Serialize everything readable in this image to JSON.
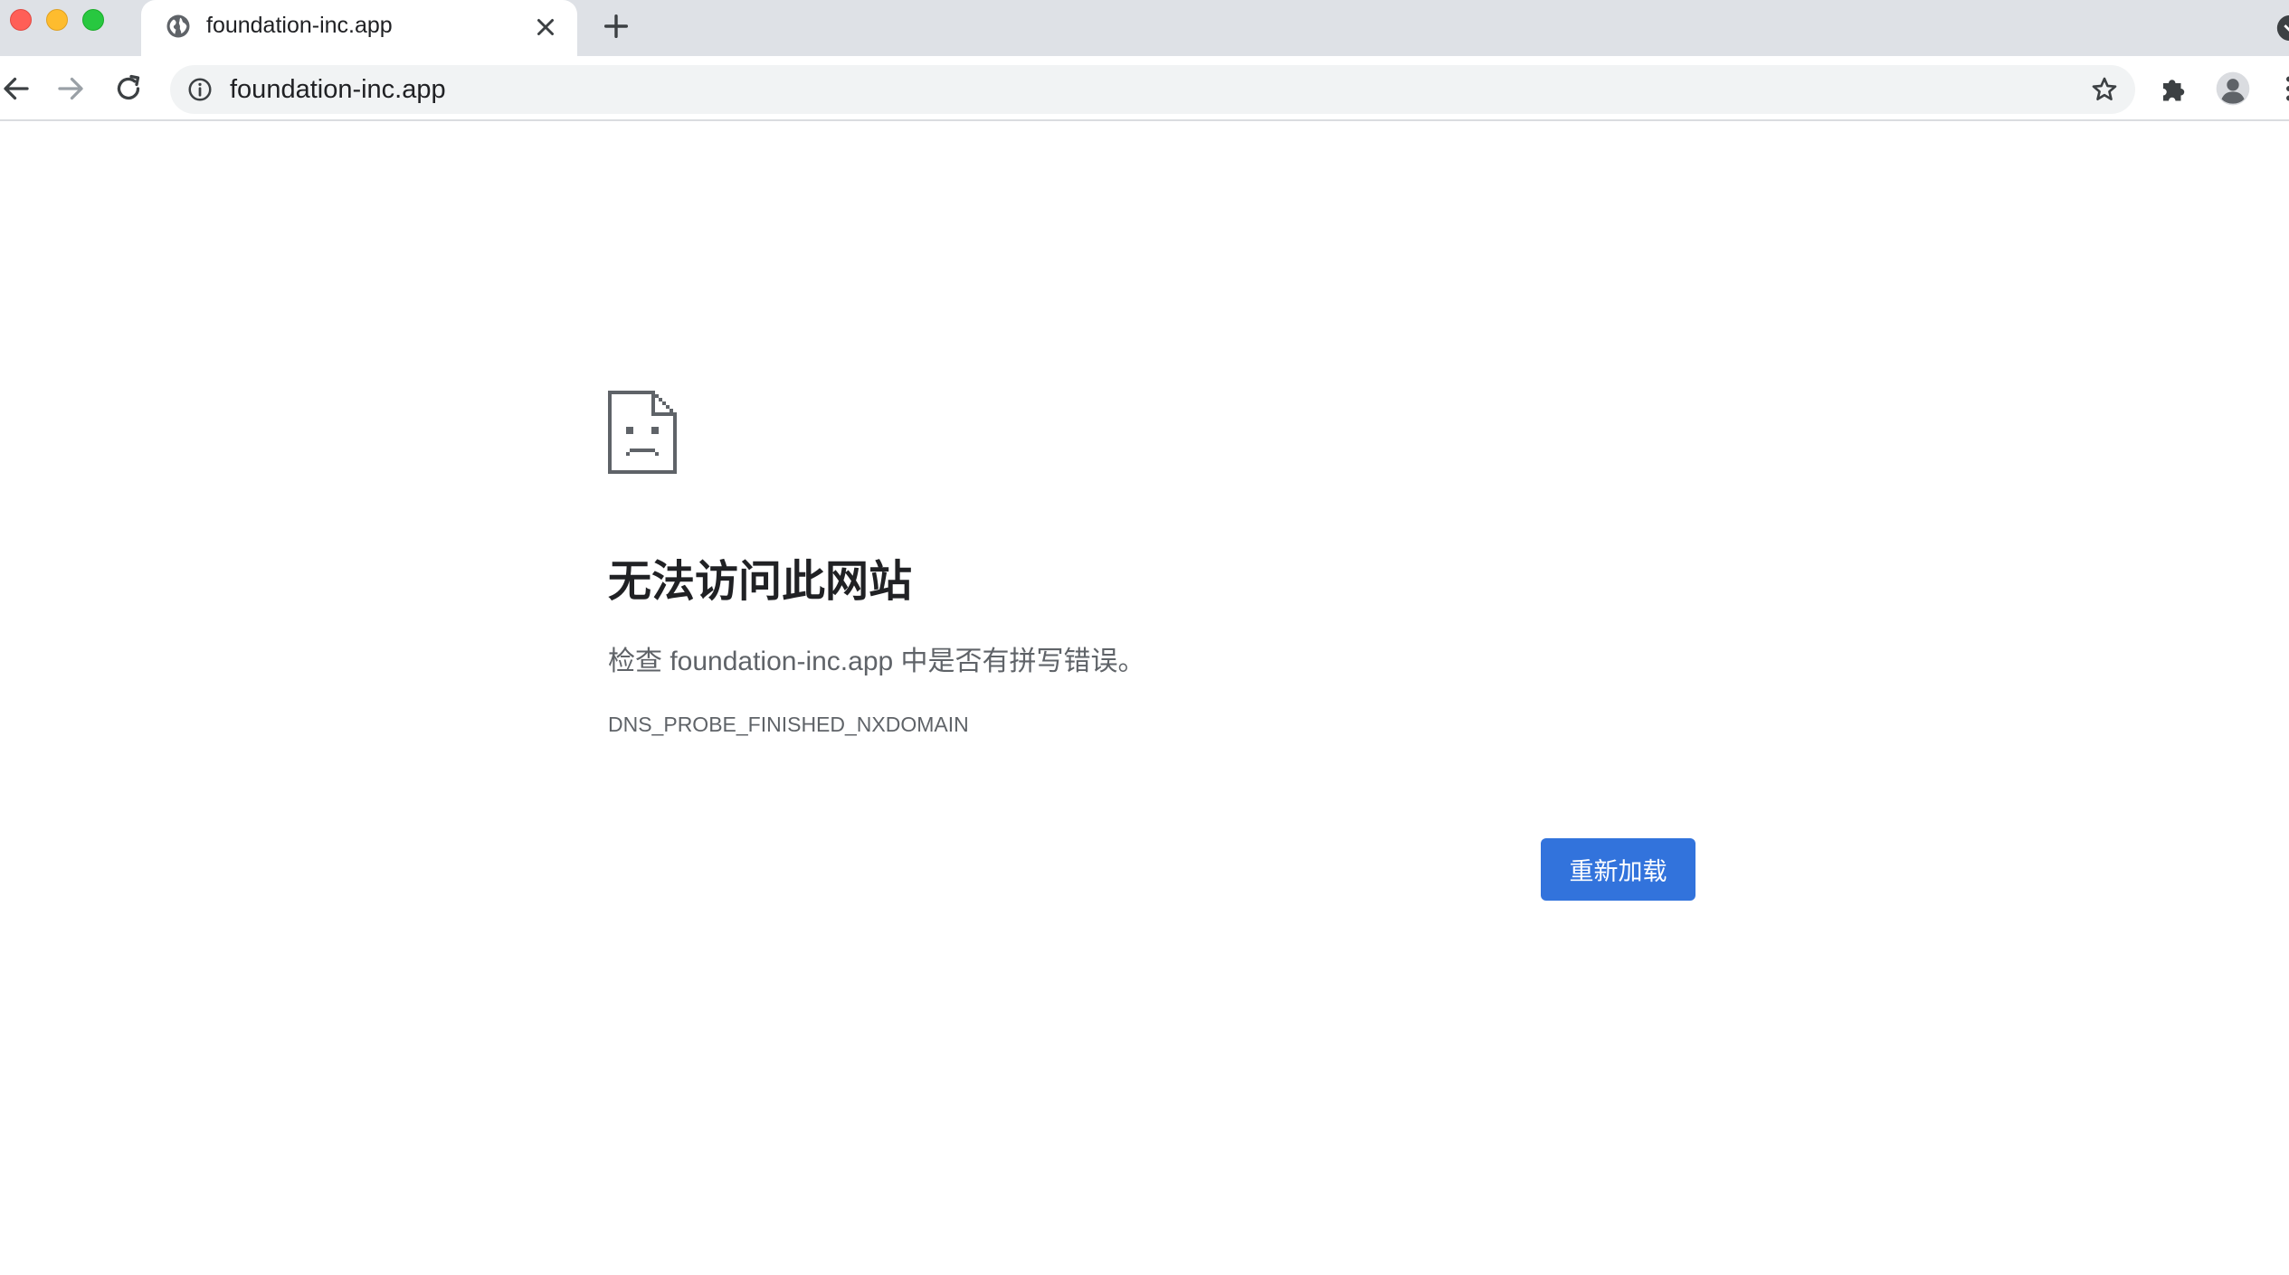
{
  "browser": {
    "tab": {
      "title": "foundation-inc.app",
      "favicon": "globe-icon",
      "close_icon": "close-icon"
    },
    "new_tab_icon": "plus-icon",
    "toolbar": {
      "back_icon": "back-arrow-icon",
      "forward_icon": "forward-arrow-icon",
      "reload_icon": "reload-icon",
      "site_info_icon": "info-icon",
      "url": "foundation-inc.app",
      "bookmark_icon": "star-icon",
      "extensions_icon": "puzzle-icon",
      "profile_icon": "avatar-icon",
      "menu_icon": "kebab-menu-icon"
    }
  },
  "error_page": {
    "icon": "sad-document-icon",
    "heading": "无法访问此网站",
    "description": "检查 foundation-inc.app 中是否有拼写错误。",
    "error_code": "DNS_PROBE_FINISHED_NXDOMAIN",
    "reload_button": "重新加载"
  },
  "colors": {
    "tabstrip_bg": "#dee1e6",
    "omnibox_bg": "#f1f3f4",
    "button_blue": "#3273dc",
    "heading_text": "#202124",
    "body_text": "#5f6368"
  }
}
